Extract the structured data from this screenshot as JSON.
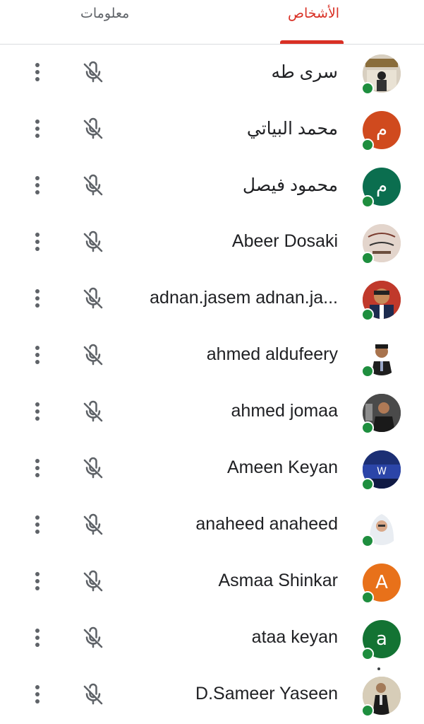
{
  "tabs": {
    "people": "الأشخاص",
    "info": "معلومات"
  },
  "colors": {
    "accent": "#d93025",
    "online": "#1e8e3e",
    "icon": "#5f6368"
  },
  "participants": [
    {
      "name": "سرى طه",
      "avatar_letter": "",
      "avatar_bg": "#d8cfc0",
      "avatar_kind": "photo-poster"
    },
    {
      "name": "محمد البياتي",
      "avatar_letter": "م",
      "avatar_bg": "#d04a1e",
      "avatar_kind": "letter"
    },
    {
      "name": "محمود فيصل",
      "avatar_letter": "م",
      "avatar_bg": "#0b6e4f",
      "avatar_kind": "letter"
    },
    {
      "name": "Abeer Dosaki",
      "avatar_letter": "",
      "avatar_bg": "#e3d5cc",
      "avatar_kind": "photo-text"
    },
    {
      "name": "adnan.jasem adnan.ja...",
      "avatar_letter": "",
      "avatar_bg": "#c0392b",
      "avatar_kind": "photo-face"
    },
    {
      "name": "ahmed aldufeery",
      "avatar_letter": "",
      "avatar_bg": "#ffffff",
      "avatar_kind": "photo-suit"
    },
    {
      "name": "ahmed jomaa",
      "avatar_letter": "",
      "avatar_bg": "#6b6b6b",
      "avatar_kind": "photo-dark"
    },
    {
      "name": "Ameen Keyan",
      "avatar_letter": "",
      "avatar_bg": "#1c2f74",
      "avatar_kind": "photo-blue"
    },
    {
      "name": "anaheed anaheed",
      "avatar_letter": "",
      "avatar_bg": "#ffffff",
      "avatar_kind": "photo-hijab"
    },
    {
      "name": "Asmaa Shinkar",
      "avatar_letter": "A",
      "avatar_bg": "#e8711a",
      "avatar_kind": "letter"
    },
    {
      "name": "ataa keyan",
      "avatar_letter": "a",
      "avatar_bg": "#137333",
      "avatar_kind": "letter"
    },
    {
      "name": "D.Sameer Yaseen",
      "avatar_letter": "",
      "avatar_bg": "#cfc6b4",
      "avatar_kind": "photo-suit2"
    }
  ]
}
